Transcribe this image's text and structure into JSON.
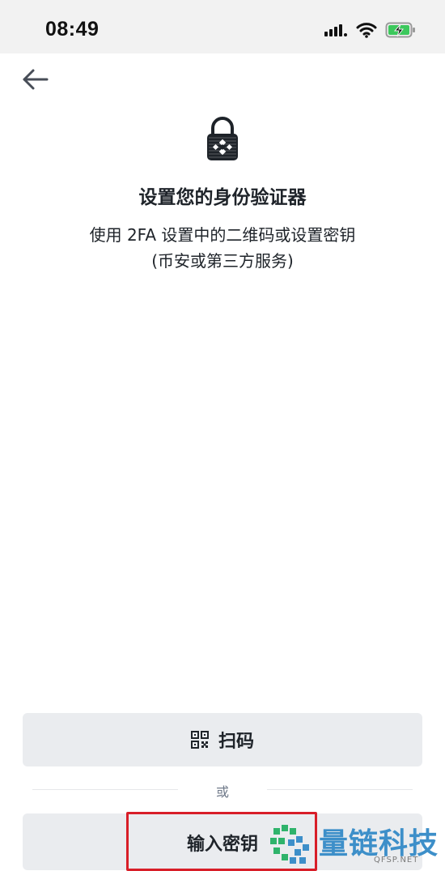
{
  "status_bar": {
    "time": "08:49",
    "icons": [
      "signal-icon",
      "wifi-icon",
      "battery-charging-icon"
    ],
    "battery_color": "#3cc85c"
  },
  "header": {
    "back_icon": "arrow-left-icon"
  },
  "main": {
    "lock_icon": "binance-lock-icon",
    "title": "设置您的身份验证器",
    "subtitle_line1": "使用 2FA 设置中的二维码或设置密钥",
    "subtitle_line2": "(币安或第三方服务)"
  },
  "actions": {
    "scan_icon": "qr-code-icon",
    "scan_label": "扫码",
    "or_label": "或",
    "key_label": "输入密钥",
    "highlight_color": "#d81e28"
  },
  "watermark": {
    "text": "量链科技",
    "sub": "QFSP.NET",
    "color": "#3d8fc9"
  }
}
